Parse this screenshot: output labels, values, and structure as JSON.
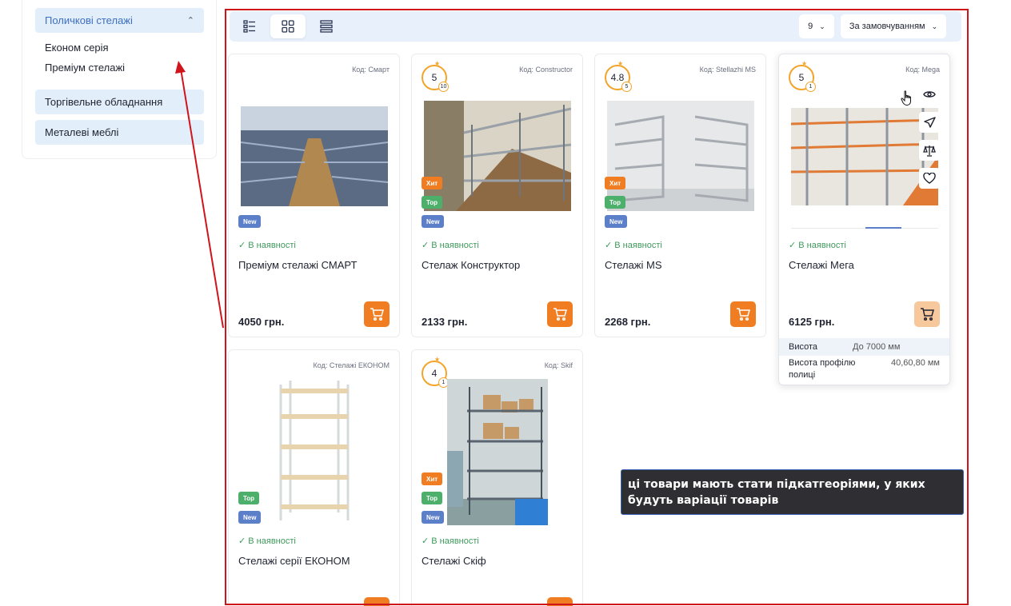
{
  "sidebar": {
    "categories": [
      {
        "label": "Поличкові стелажі",
        "active": true
      },
      {
        "label": "Торгівельне обладнання"
      },
      {
        "label": "Металеві меблі"
      }
    ],
    "subcategories": [
      "Економ серія",
      "Преміум стелажі"
    ]
  },
  "toolbar": {
    "views": [
      "list-view",
      "grid-view",
      "compact-view"
    ],
    "active_view": "grid-view",
    "per_page": "9",
    "sort": "За замовчуванням"
  },
  "products": [
    {
      "code": "Код: Смарт",
      "badges": [
        "New"
      ],
      "stock": "В наявності",
      "name": "Преміум стелажі СМАРТ",
      "price": "4050 грн."
    },
    {
      "code": "Код: Constructor",
      "rating": "5",
      "reviews": "10",
      "badges": [
        "Хит",
        "Top",
        "New"
      ],
      "stock": "В наявності",
      "name": "Стелаж Конструктор",
      "price": "2133 грн."
    },
    {
      "code": "Код: Stellazhi MS",
      "rating": "4.8",
      "reviews": "5",
      "badges": [
        "Хит",
        "Top",
        "New"
      ],
      "stock": "В наявності",
      "name": "Стелажі MS",
      "price": "2268 грн."
    },
    {
      "code": "Код: Mega",
      "rating": "5",
      "reviews": "1",
      "badges": [],
      "stock": "В наявності",
      "name": "Стелажі Мега",
      "price": "6125 грн.",
      "specs": [
        {
          "key": "Висота",
          "value": "До 7000 мм"
        },
        {
          "key": "Висота профілю полиці",
          "value": "40,60,80 мм"
        }
      ]
    },
    {
      "code": "Код: Стелажі ЕКОНОМ",
      "badges": [
        "Top",
        "New"
      ],
      "stock": "В наявності",
      "name": "Стелажі серії ЕКОНОМ"
    },
    {
      "code": "Код: Skif",
      "rating": "4",
      "reviews": "1",
      "badges": [
        "Хит",
        "Top",
        "New"
      ],
      "stock": "В наявності",
      "name": "Стелажі Скіф"
    }
  ],
  "annotation": {
    "text": "ці товари мають стати підкатгеоріями, у яких будуть варіації товарів"
  },
  "colors": {
    "accent": "#f07d21",
    "frame": "#d0141c",
    "link": "#3d6fc2",
    "stock": "#3f9a5c"
  }
}
